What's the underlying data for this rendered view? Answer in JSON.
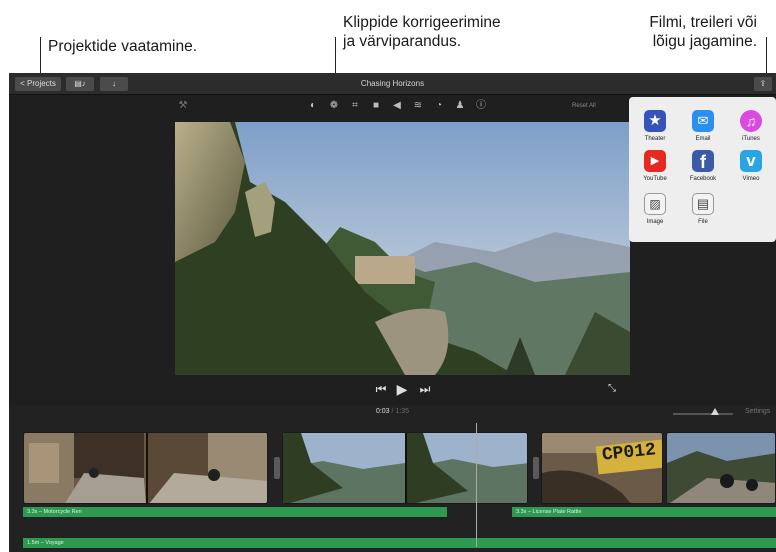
{
  "callouts": {
    "left": "Projektide vaatamine.",
    "center_line1": "Klippide korrigeerimine",
    "center_line2": "ja värviparandus.",
    "right_line1": "Filmi, treileri või",
    "right_line2": "lõigu jagamine."
  },
  "topbar": {
    "back_label": "< Projects",
    "title": "Chasing Horizons"
  },
  "viewer": {
    "reset_all_label": "Reset All",
    "tools": [
      "color-balance-icon",
      "filter-icon",
      "crop-icon",
      "video-camera-icon",
      "volume-icon",
      "audio-equalizer-icon",
      "speed-icon",
      "stamp-icon",
      "info-icon"
    ],
    "controls": {
      "previous": "⏮",
      "play": "▶",
      "next": "⏭"
    }
  },
  "share": {
    "items": [
      {
        "label": "Theater",
        "icon": "star-icon",
        "color": "#3653b8"
      },
      {
        "label": "Email",
        "icon": "mail-icon",
        "color": "#2b8ff0"
      },
      {
        "label": "iTunes",
        "icon": "music-note-icon",
        "color": "#d94be0"
      },
      {
        "label": "YouTube",
        "icon": "youtube-icon",
        "color": "#e52b21"
      },
      {
        "label": "Facebook",
        "icon": "facebook-icon",
        "color": "#3b5ba8"
      },
      {
        "label": "Vimeo",
        "icon": "vimeo-icon",
        "color": "#2aa5e3"
      },
      {
        "label": "Image",
        "icon": "image-icon",
        "color": "#f3f3f3"
      },
      {
        "label": "File",
        "icon": "film-icon",
        "color": "#f3f3f3"
      }
    ]
  },
  "timeline": {
    "current_time": "0:03",
    "total_time": "/ 1:35",
    "settings_label": "Settings",
    "zoom_level": 0.7,
    "bars": {
      "clip1": "3.3s – Motorcycle Ren",
      "clip2": "3.3s – License Plate Rattle",
      "music": "1.5m – Voyage"
    },
    "plate_text": "CP012"
  }
}
